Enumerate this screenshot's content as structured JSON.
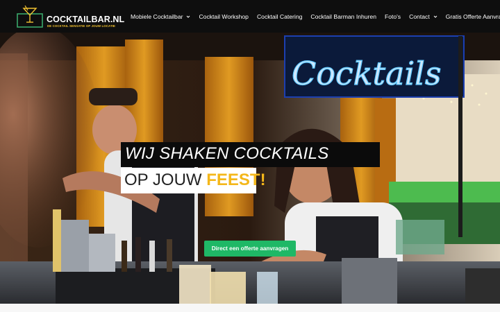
{
  "brand": {
    "name": "COCKTAILBAR.NL",
    "tagline": "De cocktail sensatie op jouw locatie",
    "icon": "cocktail-glass-logo-icon",
    "colors": {
      "logo_green": "#3aa86b",
      "logo_yellow": "#f2c230"
    }
  },
  "nav": {
    "items": [
      {
        "label": "Mobiele Cocktailbar",
        "has_dropdown": true
      },
      {
        "label": "Cocktail Workshop",
        "has_dropdown": false
      },
      {
        "label": "Cocktail Catering",
        "has_dropdown": false
      },
      {
        "label": "Cocktail Barman Inhuren",
        "has_dropdown": false
      },
      {
        "label": "Foto's",
        "has_dropdown": false
      },
      {
        "label": "Contact",
        "has_dropdown": true
      },
      {
        "label": "Gratis Offerte Aanvragen",
        "has_dropdown": false
      }
    ]
  },
  "hero": {
    "neon_sign": "Cocktails",
    "headline_line1": "WIJ SHAKEN COCKTAILS",
    "headline_line2_prefix": "OP JOUW",
    "headline_line2_accent": "FEEST!",
    "cta_label": "Direct een offerte aanvragen",
    "colors": {
      "accent": "#f4b71a",
      "cta": "#1fb866",
      "header_bg": "#0e0e0e"
    }
  }
}
